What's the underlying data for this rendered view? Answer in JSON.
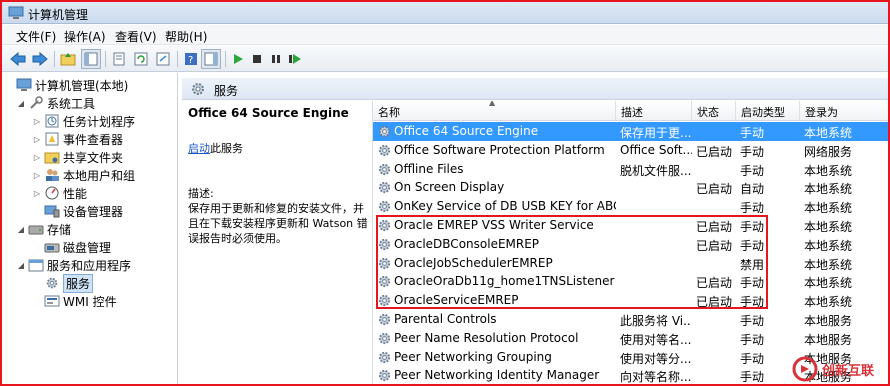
{
  "window": {
    "title": "计算机管理"
  },
  "menu": [
    "文件(F)",
    "操作(A)",
    "查看(V)",
    "帮助(H)"
  ],
  "toolbar": {
    "icons": [
      "back-icon",
      "forward-icon",
      "up-folder-icon",
      "console-tree-icon",
      "properties-icon",
      "refresh-icon",
      "export-icon",
      "help-icon",
      "action-pane-icon",
      "play-icon",
      "stop-icon",
      "pause-icon",
      "restart-icon"
    ]
  },
  "tree": [
    {
      "label": "计算机管理(本地)",
      "level": 0,
      "expander": "",
      "icon": "computer-icon"
    },
    {
      "label": "系统工具",
      "level": 1,
      "expander": "◢",
      "icon": "tools-icon"
    },
    {
      "label": "任务计划程序",
      "level": 2,
      "expander": "▷",
      "icon": "task-scheduler-icon"
    },
    {
      "label": "事件查看器",
      "level": 2,
      "expander": "▷",
      "icon": "event-viewer-icon"
    },
    {
      "label": "共享文件夹",
      "level": 2,
      "expander": "▷",
      "icon": "shared-folder-icon"
    },
    {
      "label": "本地用户和组",
      "level": 2,
      "expander": "▷",
      "icon": "users-icon"
    },
    {
      "label": "性能",
      "level": 2,
      "expander": "▷",
      "icon": "performance-icon"
    },
    {
      "label": "设备管理器",
      "level": 2,
      "expander": "",
      "icon": "device-manager-icon"
    },
    {
      "label": "存储",
      "level": 1,
      "expander": "◢",
      "icon": "storage-icon"
    },
    {
      "label": "磁盘管理",
      "level": 2,
      "expander": "",
      "icon": "disk-icon"
    },
    {
      "label": "服务和应用程序",
      "level": 1,
      "expander": "◢",
      "icon": "services-apps-icon"
    },
    {
      "label": "服务",
      "level": 2,
      "expander": "",
      "icon": "services-icon",
      "selected": true
    },
    {
      "label": "WMI 控件",
      "level": 2,
      "expander": "",
      "icon": "wmi-icon"
    }
  ],
  "content_header": {
    "title": "服务"
  },
  "description": {
    "service_name": "Office 64 Source Engine",
    "start_link": "启动",
    "start_suffix": "此服务",
    "label": "描述:",
    "text": "保存用于更新和修复的安装文件，并且在下载安装程序更新和 Watson 错误报告时必须使用。"
  },
  "columns": {
    "name": "名称",
    "desc": "描述",
    "status": "状态",
    "startup": "启动类型",
    "logon": "登录为"
  },
  "services": [
    {
      "name": "Office 64 Source Engine",
      "desc": "保存用于更...",
      "status": "",
      "startup": "手动",
      "logon": "本地系统",
      "selected": true
    },
    {
      "name": "Office Software Protection Platform",
      "desc": "Office Soft...",
      "status": "已启动",
      "startup": "手动",
      "logon": "网络服务"
    },
    {
      "name": "Offline Files",
      "desc": "脱机文件服...",
      "status": "",
      "startup": "手动",
      "logon": "本地系统"
    },
    {
      "name": "On Screen Display",
      "desc": "",
      "status": "已启动",
      "startup": "自动",
      "logon": "本地系统"
    },
    {
      "name": "OnKey Service of DB USB KEY for ABC",
      "desc": "",
      "status": "",
      "startup": "手动",
      "logon": "本地系统"
    },
    {
      "name": "Oracle EMREP VSS Writer Service",
      "desc": "",
      "status": "已启动",
      "startup": "手动",
      "logon": "本地系统"
    },
    {
      "name": "OracleDBConsoleEMREP",
      "desc": "",
      "status": "已启动",
      "startup": "手动",
      "logon": "本地系统"
    },
    {
      "name": "OracleJobSchedulerEMREP",
      "desc": "",
      "status": "",
      "startup": "禁用",
      "logon": "本地系统"
    },
    {
      "name": "OracleOraDb11g_home1TNSListener",
      "desc": "",
      "status": "已启动",
      "startup": "手动",
      "logon": "本地系统"
    },
    {
      "name": "OracleServiceEMREP",
      "desc": "",
      "status": "已启动",
      "startup": "手动",
      "logon": "本地系统"
    },
    {
      "name": "Parental Controls",
      "desc": "此服务将 Vi...",
      "status": "",
      "startup": "手动",
      "logon": "本地服务"
    },
    {
      "name": "Peer Name Resolution Protocol",
      "desc": "使用对等名...",
      "status": "",
      "startup": "手动",
      "logon": "本地服务"
    },
    {
      "name": "Peer Networking Grouping",
      "desc": "使用对等分...",
      "status": "",
      "startup": "手动",
      "logon": "本地服务"
    },
    {
      "name": "Peer Networking Identity Manager",
      "desc": "向对等名称...",
      "status": "",
      "startup": "手动",
      "logon": "本地服务"
    }
  ],
  "watermark": {
    "text": "创新互联"
  },
  "colors": {
    "selection": "#3399ff",
    "highlight_border": "#e8141e",
    "link": "#1a55c8"
  }
}
